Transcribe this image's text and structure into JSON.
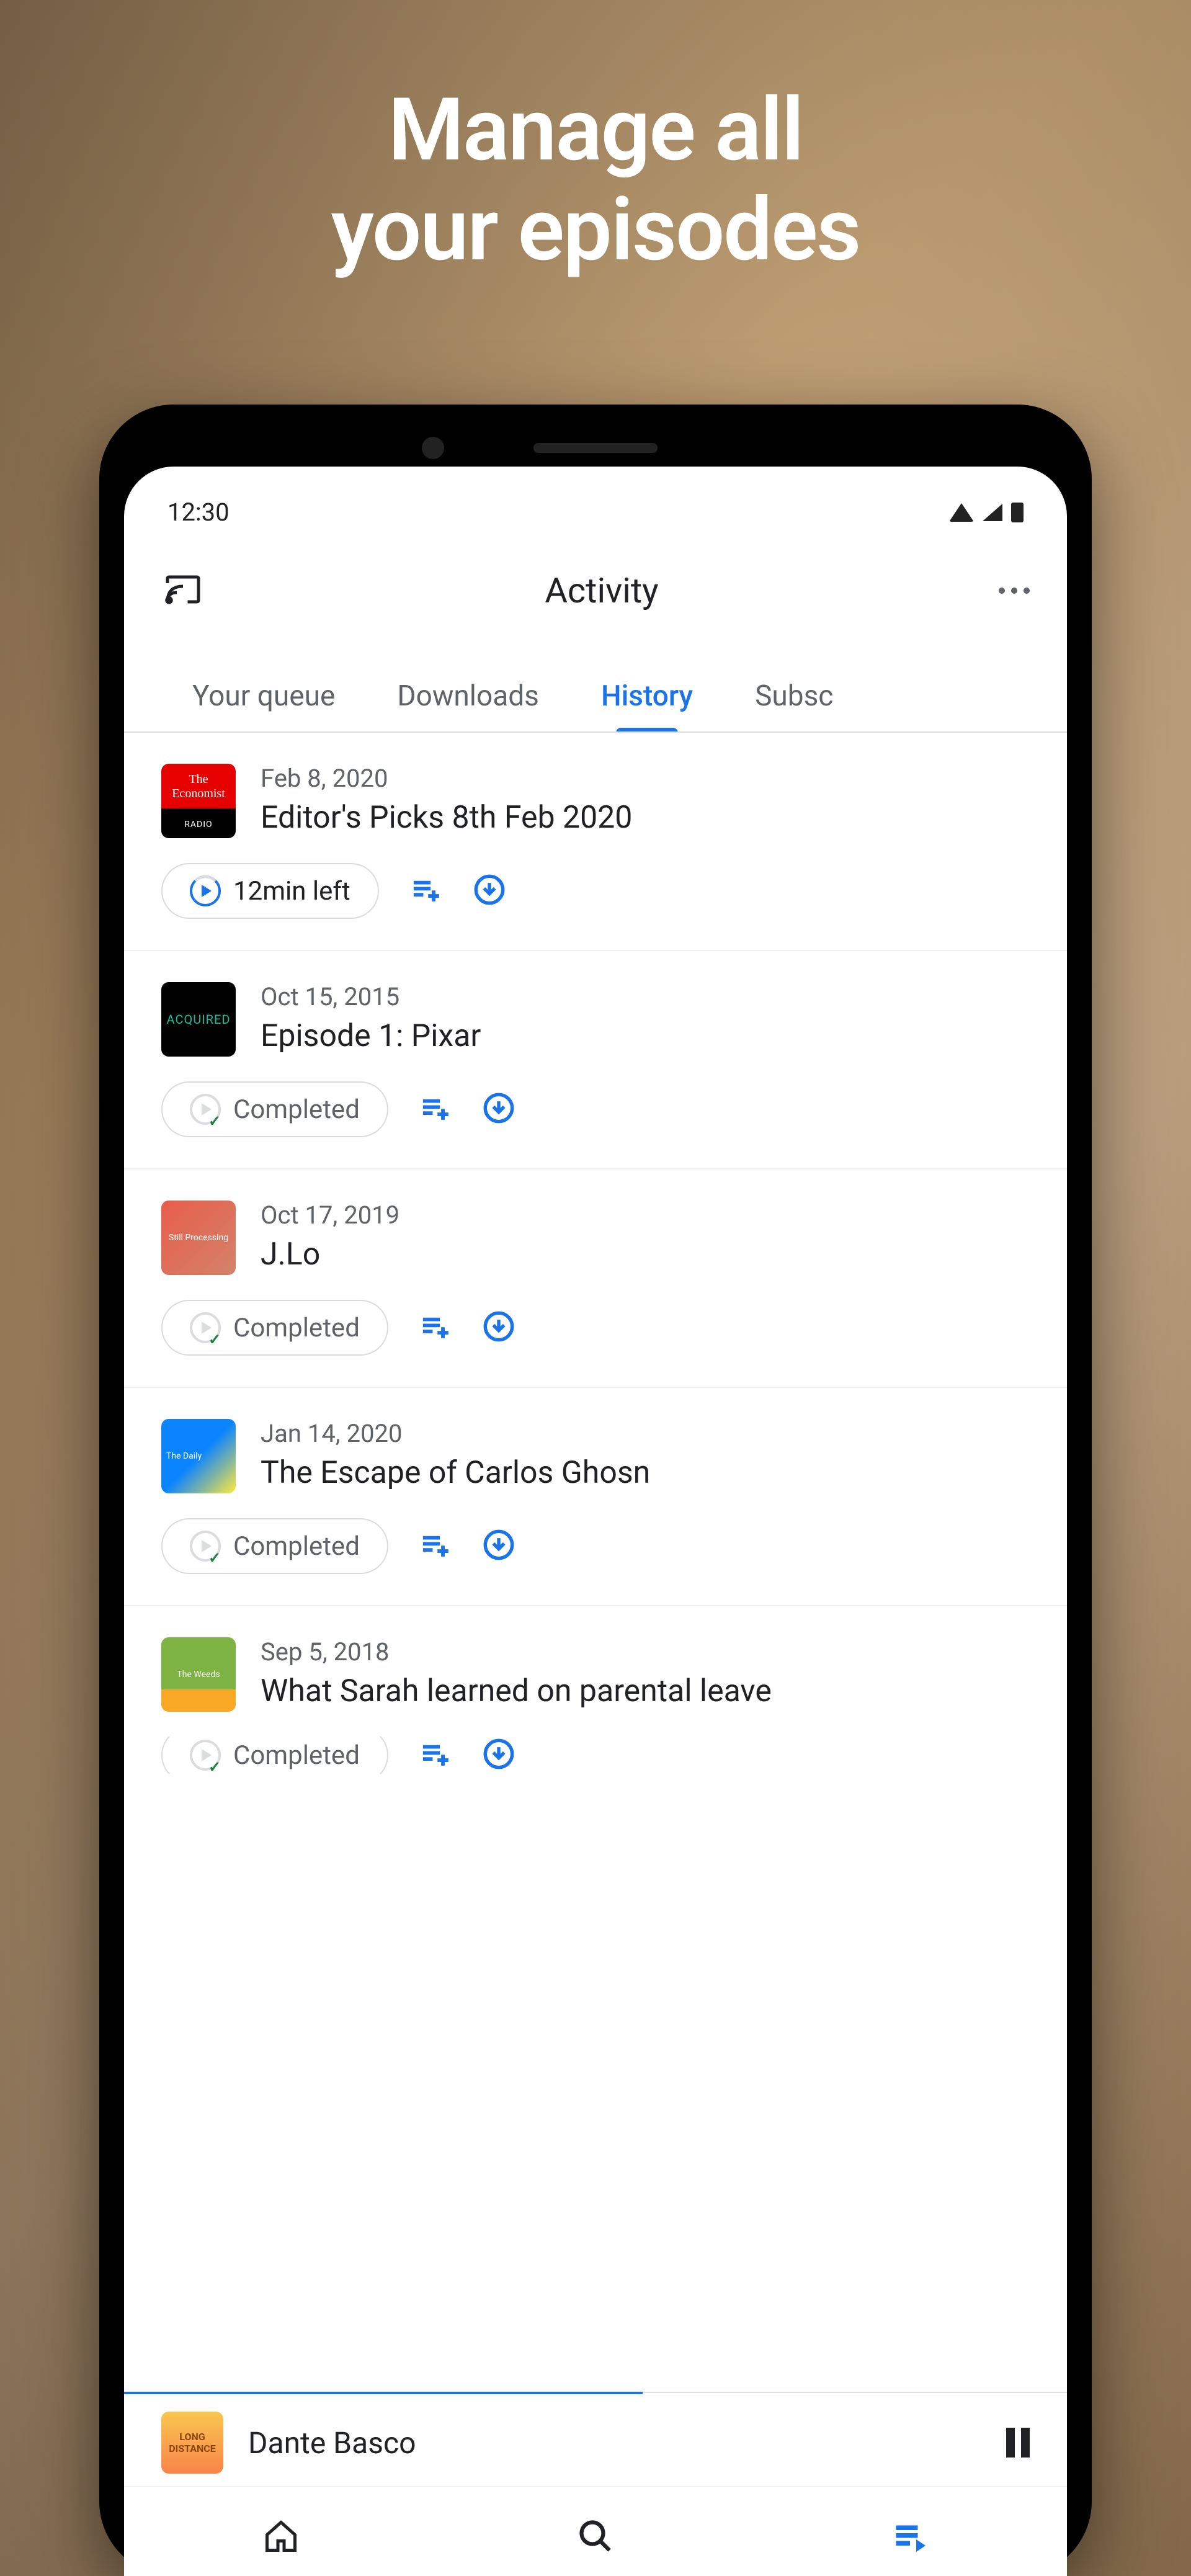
{
  "hero": {
    "line1": "Manage all",
    "line2": "your episodes"
  },
  "statusBar": {
    "time": "12:30"
  },
  "header": {
    "title": "Activity"
  },
  "tabs": [
    {
      "label": "Your queue",
      "active": false
    },
    {
      "label": "Downloads",
      "active": false
    },
    {
      "label": "History",
      "active": true
    },
    {
      "label": "Subsc",
      "active": false
    }
  ],
  "episodes": [
    {
      "date": "Feb 8, 2020",
      "title": "Editor's Picks 8th Feb 2020",
      "status": "12min left",
      "statusType": "progress",
      "art": "economist"
    },
    {
      "date": "Oct 15, 2015",
      "title": "Episode 1: Pixar",
      "status": "Completed",
      "statusType": "done",
      "art": "acquired"
    },
    {
      "date": "Oct 17, 2019",
      "title": "J.Lo",
      "status": "Completed",
      "statusType": "done",
      "art": "still"
    },
    {
      "date": "Jan 14, 2020",
      "title": "The Escape of Carlos Ghosn",
      "status": "Completed",
      "statusType": "done",
      "art": "daily"
    },
    {
      "date": "Sep 5, 2018",
      "title": "What Sarah learned on parental leave",
      "status": "Completed",
      "statusType": "done",
      "art": "weeds"
    }
  ],
  "nowPlaying": {
    "title": "Dante Basco",
    "art": "long"
  },
  "podcastArt": {
    "economist": {
      "line1": "The",
      "line2": "Economist",
      "line3": "RADIO"
    },
    "acquired": {
      "text": "ACQUIRED"
    },
    "still": {
      "text": "Still Processing"
    },
    "daily": {
      "text": "The Daily"
    },
    "weeds": {
      "text": "The Weeds"
    },
    "long": {
      "line1": "LONG",
      "line2": "DISTANCE"
    }
  }
}
